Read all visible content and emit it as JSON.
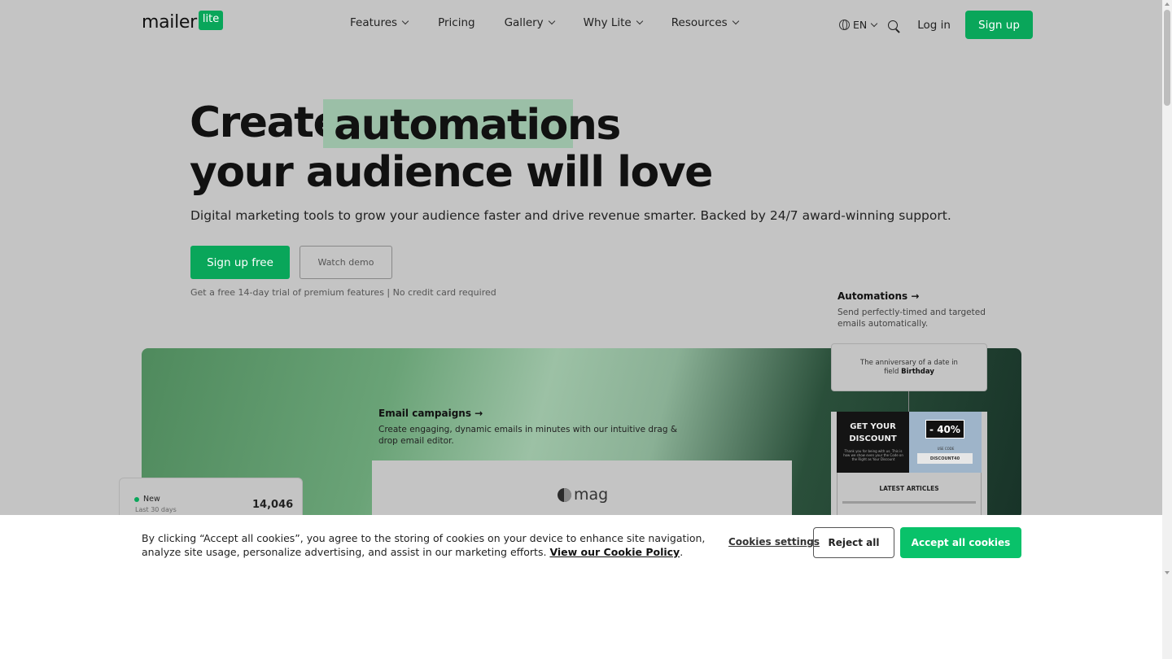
{
  "nav": {
    "logo_word": "mailer",
    "logo_badge": "lite",
    "items": [
      {
        "label": "Features",
        "dropdown": true
      },
      {
        "label": "Pricing",
        "dropdown": false
      },
      {
        "label": "Gallery",
        "dropdown": true
      },
      {
        "label": "Why Lite",
        "dropdown": true
      },
      {
        "label": "Resources",
        "dropdown": true
      }
    ],
    "language": "EN",
    "login": "Log in",
    "signup": "Sign up"
  },
  "hero": {
    "word_create": "Create",
    "word_highlight": "automations",
    "line2": "your audience will love",
    "subtitle": "Digital marketing tools to grow your audience faster and drive revenue smarter. Backed by 24/7 award-winning support.",
    "cta_primary": "Sign up free",
    "cta_secondary": "Watch demo",
    "note": "Get a free 14-day trial of premium features | No credit card required"
  },
  "features": {
    "automations_title": "Automations →",
    "automations_desc": "Send perfectly-timed and targeted emails automatically.",
    "email_title": "Email campaigns →",
    "email_desc": "Create engaging, dynamic emails in minutes with our intuitive drag & drop email editor."
  },
  "preview": {
    "mag_brand": "mag",
    "stats_label": "New",
    "stats_sub": "Last 30 days",
    "stats_value": "14,046",
    "trigger_text": "The anniversary of a date in field",
    "trigger_field": "Birthday",
    "promo_headline": "GET YOUR DISCOUNT",
    "promo_small": "Thank you for being with us. This is how we show even your the Code on the Right as Your Discount",
    "promo_percent": "- 40%",
    "promo_code_label": "USE CODE",
    "promo_code": "DISCOUNT40",
    "latest_articles": "LATEST ARTICLES"
  },
  "cookie": {
    "text": "By clicking “Accept all cookies”, you agree to the storing of cookies on your device to enhance site navigation, analyze site usage, personalize advertising, and assist in our marketing efforts.",
    "policy_link": "View our Cookie Policy",
    "policy_end": ".",
    "settings": "Cookies settings",
    "reject": "Reject all",
    "accept": "Accept all cookies"
  },
  "colors": {
    "brand_green": "#09a65a",
    "accept_green": "#09c26a",
    "highlight": "#9bbfa7",
    "page_overlay": "#c4c4c4"
  }
}
